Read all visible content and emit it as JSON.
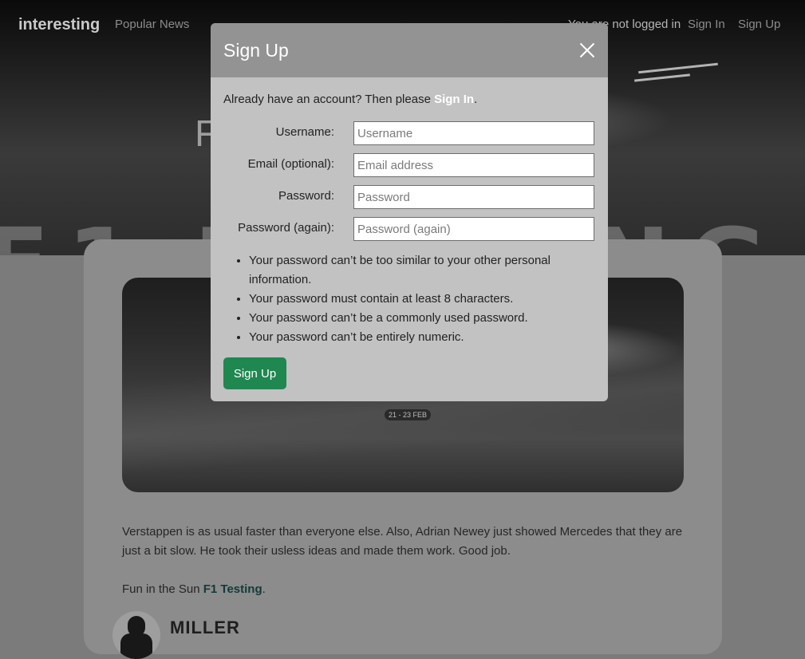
{
  "navbar": {
    "brand": "interesting",
    "popular_news": "Popular News",
    "login_status": "You are not logged in",
    "sign_in": "Sign In",
    "sign_up": "Sign Up"
  },
  "article": {
    "title": "F1 Testing is underway!!!!",
    "image_date": "21 - 23 FEB",
    "paragraph": "Verstappen is as usual faster than everyone else. Also, Adrian Newey just showed Mercedes that they are just a bit slow. He took their usless ideas and made them work. Good job.",
    "fun_prefix": "Fun in the Sun ",
    "fun_link": "F1 Testing",
    "fun_suffix": ".",
    "author_name": "MILLER"
  },
  "modal": {
    "title": "Sign Up",
    "intro_prefix": "Already have an account? Then please ",
    "intro_link": "Sign In",
    "intro_suffix": ".",
    "fields": {
      "username": {
        "label": "Username:",
        "placeholder": "Username"
      },
      "email": {
        "label": "Email (optional):",
        "placeholder": "Email address"
      },
      "password": {
        "label": "Password:",
        "placeholder": "Password"
      },
      "password_again": {
        "label": "Password (again):",
        "placeholder": "Password (again)"
      }
    },
    "rules": [
      "Your password can’t be too similar to your other personal information.",
      "Your password must contain at least 8 characters.",
      "Your password can’t be a commonly used password.",
      "Your password can’t be entirely numeric."
    ],
    "submit_label": "Sign Up"
  },
  "icons": {
    "close": "close-icon"
  },
  "colors": {
    "primary_button": "#1f8750",
    "modal_header": "#939393",
    "modal_body": "#c2c2c2"
  }
}
